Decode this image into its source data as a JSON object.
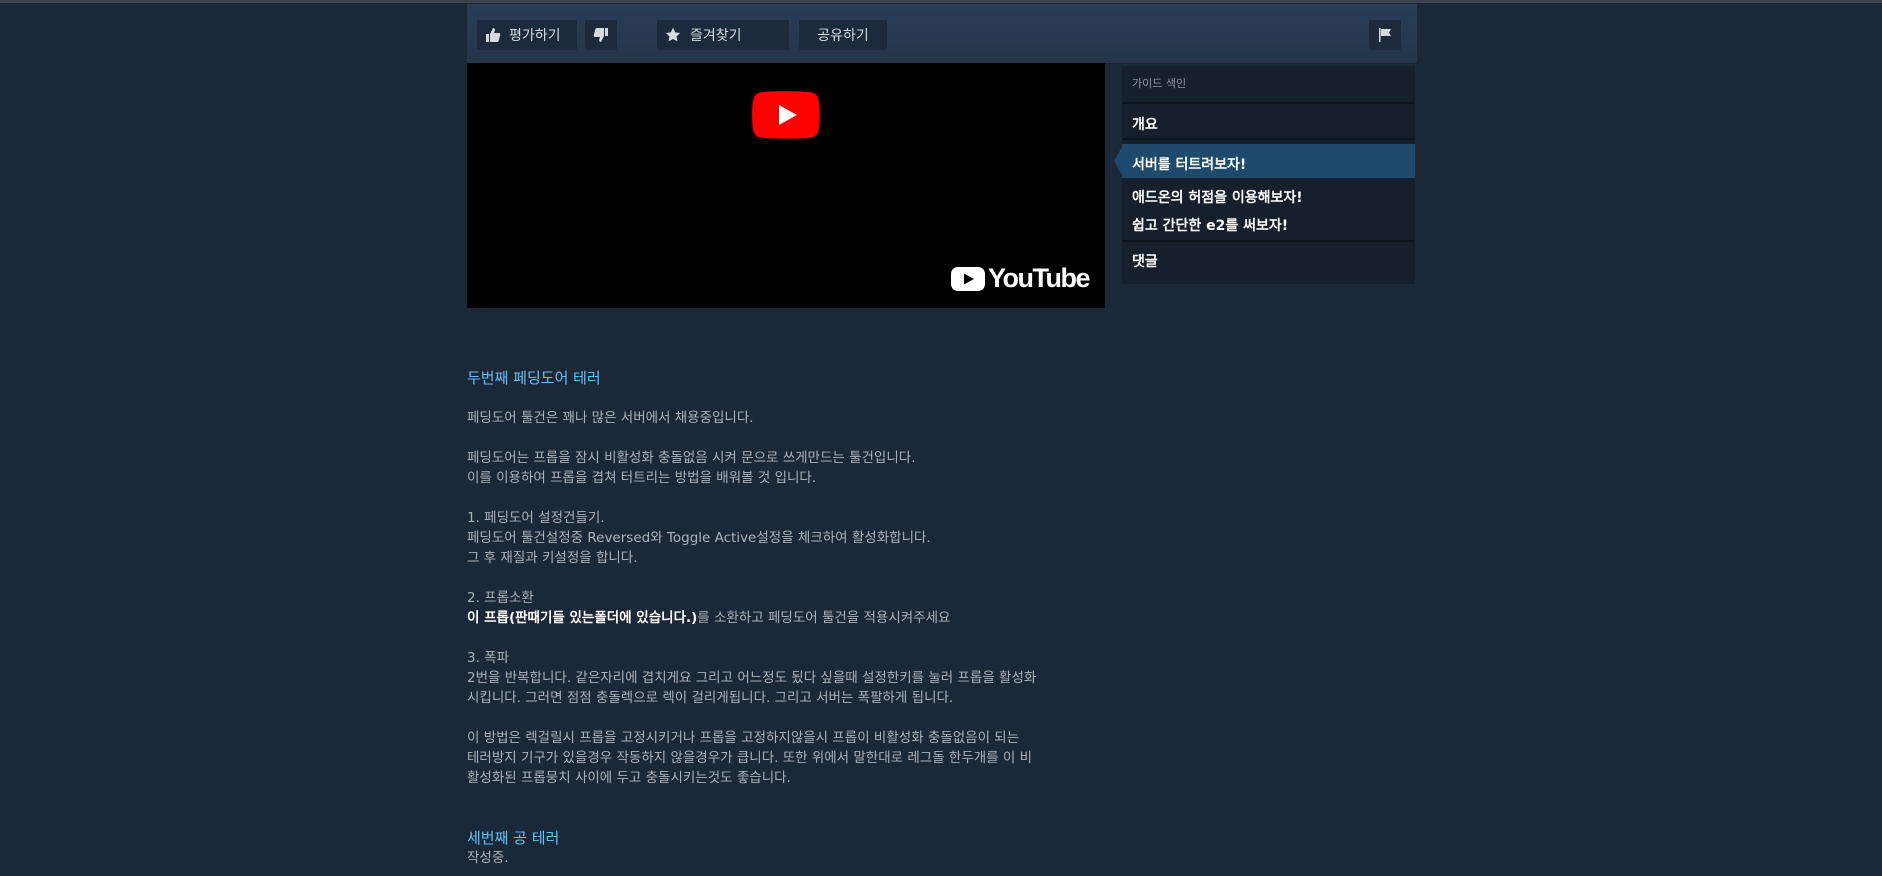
{
  "action_bar": {
    "rate_label": "평가하기",
    "favorite_label": "즐겨찾기",
    "share_label": "공유하기"
  },
  "video": {
    "brand": "YouTube"
  },
  "guide_index": {
    "title": "가이드 색인",
    "items": [
      {
        "label": "개요"
      },
      {
        "label": "서버를 터트려보자!",
        "active": true
      },
      {
        "label": "애드온의 허점을 이용해보자!"
      },
      {
        "label": "쉽고 간단한 e2를 써보자!"
      },
      {
        "label": "댓글"
      }
    ]
  },
  "content": {
    "section2": {
      "title": "두번째 페딩도어 테러",
      "p1": "페딩도어 툴건은 꽤나 많은 서버에서 채용중입니다.",
      "p2_l1": "페딩도어는 프롭을 잠시 비활성화 충돌없음 시켜 문으로 쓰게만드는 툴건입니다.",
      "p2_l2": "이를 이용하여 프롭을 겹쳐 터트리는 방법을 배워볼 것 입니다.",
      "step1_title": "1. 페딩도어 설정건들기.",
      "step1_l1": "페딩도어 툴건설정중 Reversed와 Toggle Active설정을 체크하여 활성화합니다.",
      "step1_l2": "그 후 재질과 키설정을 합니다.",
      "step2_title": "2. 프롭소환",
      "step2_bold": "이 프롭(판때기들 있는폴더에 있습니다.)",
      "step2_rest": "를 소환하고 페딩도어 툴건을 적용시켜주세요",
      "step3_title": "3. 폭파",
      "step3_l1": "2번을 반복합니다. 같은자리에 겹치게요 그리고 어느정도 됬다 싶을때 설정한키를 눌러 프롭을 활성화",
      "step3_l2": "시킵니다. 그러면 점점 충돌렉으로 렉이 걸리게됩니다. 그리고 서버는 폭팔하게 됩니다.",
      "note_l1": "이 방법은 렉걸릴시 프롭을 고정시키거나 프롭을 고정하지않을시 프롭이 비활성화 충돌없음이 되는",
      "note_l2": "테러방지 기구가 있을경우 작동하지 않을경우가 큽니다. 또한 위에서 말한대로 레그돌 한두개를 이 비",
      "note_l3": "활성화된 프롭뭉치 사이에 두고 충돌시키는것도 좋습니다."
    },
    "section3": {
      "title": "세번째 공 테러",
      "p1": "작성중."
    }
  },
  "colors": {
    "page_bg": "#1b2838",
    "accent_link": "#66c0f4",
    "active_index": "#1f4a6b",
    "yt_red": "#ff0000"
  }
}
